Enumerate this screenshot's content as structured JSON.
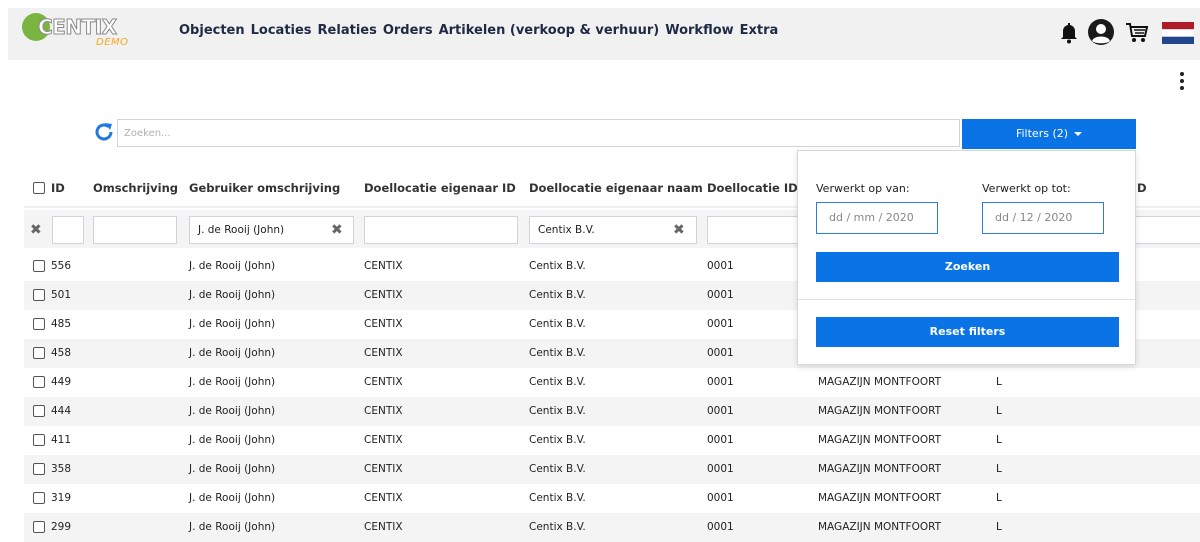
{
  "brand": {
    "logo_text": "CENTIX",
    "logo_sub": "DEMO"
  },
  "nav": {
    "items": [
      "Objecten",
      "Locaties",
      "Relaties",
      "Orders",
      "Artikelen (verkoop & verhuur)",
      "Workflow",
      "Extra"
    ],
    "icons": [
      "bell-icon",
      "user-icon",
      "cart-icon",
      "flag-nl-icon"
    ]
  },
  "search": {
    "placeholder": "Zoeken..."
  },
  "filter_button": {
    "label": "Filters (2)"
  },
  "table": {
    "columns": [
      "ID",
      "Omschrijving",
      "Gebruiker omschrijving",
      "Doellocatie eigenaar ID",
      "Doellocatie eigenaar naam",
      "Doellocatie ID",
      "D"
    ],
    "filters": {
      "gebruiker": "J. de Rooij (John)",
      "eigenaar_naam": "Centix B.V."
    },
    "rows": [
      {
        "id": "556",
        "gebruiker": "J. de Rooij (John)",
        "eigenaar_id": "CENTIX",
        "eigenaar_naam": "Centix B.V.",
        "locatie_id": "0001",
        "locatie": "",
        "code": ""
      },
      {
        "id": "501",
        "gebruiker": "J. de Rooij (John)",
        "eigenaar_id": "CENTIX",
        "eigenaar_naam": "Centix B.V.",
        "locatie_id": "0001",
        "locatie": "",
        "code": ""
      },
      {
        "id": "485",
        "gebruiker": "J. de Rooij (John)",
        "eigenaar_id": "CENTIX",
        "eigenaar_naam": "Centix B.V.",
        "locatie_id": "0001",
        "locatie": "",
        "code": ""
      },
      {
        "id": "458",
        "gebruiker": "J. de Rooij (John)",
        "eigenaar_id": "CENTIX",
        "eigenaar_naam": "Centix B.V.",
        "locatie_id": "0001",
        "locatie": "",
        "code": ""
      },
      {
        "id": "449",
        "gebruiker": "J. de Rooij (John)",
        "eigenaar_id": "CENTIX",
        "eigenaar_naam": "Centix B.V.",
        "locatie_id": "0001",
        "locatie": "MAGAZIJN MONTFOORT",
        "code": "L"
      },
      {
        "id": "444",
        "gebruiker": "J. de Rooij (John)",
        "eigenaar_id": "CENTIX",
        "eigenaar_naam": "Centix B.V.",
        "locatie_id": "0001",
        "locatie": "MAGAZIJN MONTFOORT",
        "code": "L"
      },
      {
        "id": "411",
        "gebruiker": "J. de Rooij (John)",
        "eigenaar_id": "CENTIX",
        "eigenaar_naam": "Centix B.V.",
        "locatie_id": "0001",
        "locatie": "MAGAZIJN MONTFOORT",
        "code": "L"
      },
      {
        "id": "358",
        "gebruiker": "J. de Rooij (John)",
        "eigenaar_id": "CENTIX",
        "eigenaar_naam": "Centix B.V.",
        "locatie_id": "0001",
        "locatie": "MAGAZIJN MONTFOORT",
        "code": "L"
      },
      {
        "id": "319",
        "gebruiker": "J. de Rooij (John)",
        "eigenaar_id": "CENTIX",
        "eigenaar_naam": "Centix B.V.",
        "locatie_id": "0001",
        "locatie": "MAGAZIJN MONTFOORT",
        "code": "L"
      },
      {
        "id": "299",
        "gebruiker": "J. de Rooij (John)",
        "eigenaar_id": "CENTIX",
        "eigenaar_naam": "Centix B.V.",
        "locatie_id": "0001",
        "locatie": "MAGAZIJN MONTFOORT",
        "code": "L"
      }
    ]
  },
  "filter_panel": {
    "from_label": "Verwerkt op van:",
    "to_label": "Verwerkt op tot:",
    "from_value": "dd  /  mm  /  2020",
    "to_value": "dd  /  12  /  2020",
    "search_label": "Zoeken",
    "reset_label": "Reset filters"
  },
  "colors": {
    "primary": "#0a74e6",
    "nav_bg": "#f1f1f1",
    "logo_green": "#7ab441",
    "logo_orange": "#f5a623"
  }
}
